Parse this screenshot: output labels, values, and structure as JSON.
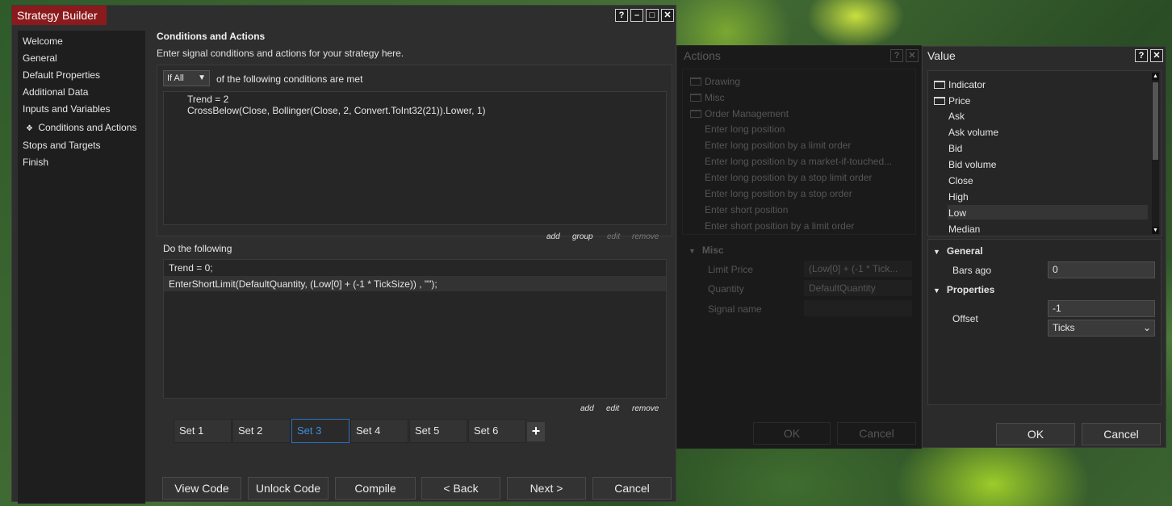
{
  "strategy_builder": {
    "title": "Strategy Builder",
    "title_buttons": [
      "?",
      "–",
      "□",
      "✕"
    ],
    "nav": [
      "Welcome",
      "General",
      "Default Properties",
      "Additional Data",
      "Inputs and Variables",
      "Conditions and Actions",
      "Stops and Targets",
      "Finish"
    ],
    "active_nav_marker": "❖",
    "section_title": "Conditions and Actions",
    "section_subtitle": "Enter signal conditions and actions for your strategy here.",
    "condition_mode": "If All",
    "condition_mode_suffix": "of the following conditions are met",
    "conditions": [
      "Trend = 2",
      "CrossBelow(Close, Bollinger(Close, 2, Convert.ToInt32(21)).Lower, 1)"
    ],
    "condition_links": {
      "add": "add",
      "group": "group",
      "edit": "edit",
      "remove": "remove"
    },
    "do_label": "Do the following",
    "actions": [
      "Trend = 0;",
      "EnterShortLimit(DefaultQuantity, (Low[0] + (-1 * TickSize)) , \"\");"
    ],
    "action_links": {
      "add": "add",
      "edit": "edit",
      "remove": "remove"
    },
    "sets": [
      "Set 1",
      "Set 2",
      "Set 3",
      "Set 4",
      "Set 5",
      "Set 6"
    ],
    "active_set": "Set 3",
    "add_set": "+",
    "buttons": {
      "view_code": "View Code",
      "unlock_code": "Unlock Code",
      "compile": "Compile",
      "back": "< Back",
      "next": "Next >",
      "cancel": "Cancel"
    }
  },
  "actions_dialog": {
    "title": "Actions",
    "title_buttons": [
      "?",
      "✕"
    ],
    "tree": [
      "Drawing",
      "Misc",
      "Order Management",
      "Enter long position",
      "Enter long position by a limit order",
      "Enter long position by a market-if-touched...",
      "Enter long position by a stop limit order",
      "Enter long position by a stop order",
      "Enter short position",
      "Enter short position by a limit order"
    ],
    "misc_header": "Misc",
    "props": [
      {
        "label": "Limit Price",
        "value": "(Low[0] + (-1 * Tick..."
      },
      {
        "label": "Quantity",
        "value": "DefaultQuantity"
      },
      {
        "label": "Signal name",
        "value": ""
      }
    ],
    "ok": "OK",
    "cancel": "Cancel"
  },
  "value_dialog": {
    "title": "Value",
    "title_buttons": [
      "?",
      "✕"
    ],
    "tree_folders": [
      "Indicator",
      "Price"
    ],
    "price_items": [
      "Ask",
      "Ask volume",
      "Bid",
      "Bid volume",
      "Close",
      "High",
      "Low",
      "Median"
    ],
    "selected_item": "Low",
    "general_header": "General",
    "bars_ago_label": "Bars ago",
    "bars_ago_value": "0",
    "properties_header": "Properties",
    "offset_label": "Offset",
    "offset_value": "-1",
    "offset_unit": "Ticks",
    "ok": "OK",
    "cancel": "Cancel"
  }
}
